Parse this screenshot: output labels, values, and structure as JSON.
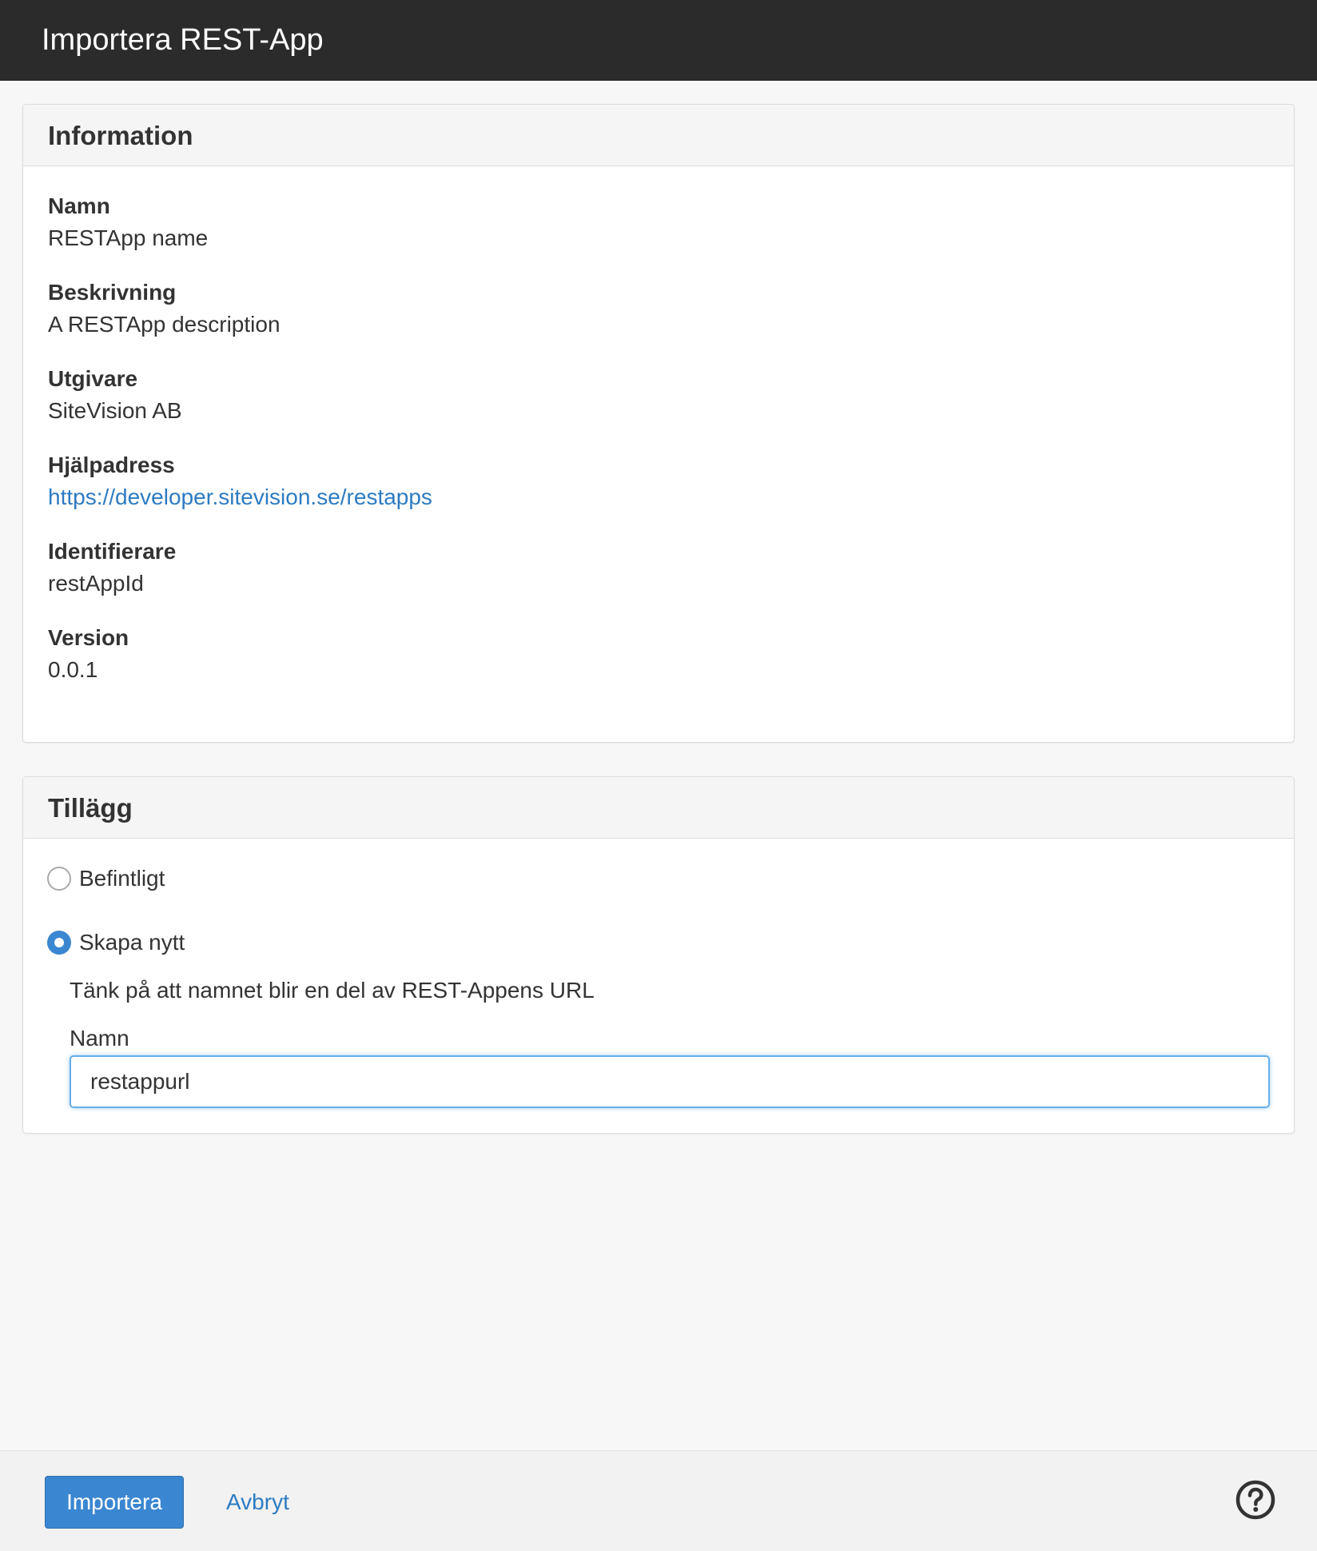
{
  "window": {
    "title": "Importera REST-App"
  },
  "information": {
    "heading": "Information",
    "fields": [
      {
        "label": "Namn",
        "value": "RESTApp name"
      },
      {
        "label": "Beskrivning",
        "value": "A RESTApp description"
      },
      {
        "label": "Utgivare",
        "value": "SiteVision AB"
      },
      {
        "label": "Hjälpadress",
        "value": "https://developer.sitevision.se/restapps"
      },
      {
        "label": "Identifierare",
        "value": "restAppId"
      },
      {
        "label": "Version",
        "value": "0.0.1"
      }
    ]
  },
  "addon": {
    "heading": "Tillägg",
    "options": [
      {
        "label": "Befintligt",
        "selected": false
      },
      {
        "label": "Skapa nytt",
        "selected": true
      }
    ],
    "hint": "Tänk på att namnet blir en del av REST-Appens URL",
    "name_label": "Namn",
    "name_value": "restappurl"
  },
  "footer": {
    "import_label": "Importera",
    "cancel_label": "Avbryt",
    "help_icon": "question-circle-icon"
  },
  "colors": {
    "titlebar": "#2b2b2b",
    "accent": "#3a86d1",
    "link": "#2d7bc2"
  }
}
